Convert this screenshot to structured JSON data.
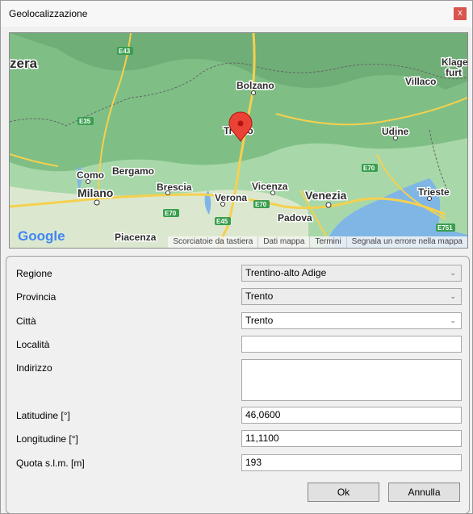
{
  "window": {
    "title": "Geolocalizzazione",
    "close_glyph": "x"
  },
  "map": {
    "places": {
      "zera": "zera",
      "klagenfurt": "Klage",
      "furt": "furt",
      "bolzano": "Bolzano",
      "villaco": "Villaco",
      "trento": "Trento",
      "udine": "Udine",
      "como": "Como",
      "bergamo": "Bergamo",
      "brescia": "Brescia",
      "milano": "Milano",
      "verona": "Verona",
      "vicenza": "Vicenza",
      "venezia": "Venezia",
      "padova": "Padova",
      "trieste": "Trieste",
      "piacenza": "Piacenza"
    },
    "roads": {
      "e43": "E43",
      "e35": "E35",
      "e70a": "E70",
      "e70b": "E70",
      "e70c": "E70",
      "e45": "E45",
      "e751": "E751"
    },
    "logo": "Google",
    "footer": {
      "shortcuts": "Scorciatoie da tastiera",
      "data": "Dati mappa",
      "terms": "Termini",
      "report": "Segnala un errore nella mappa"
    }
  },
  "form": {
    "regione": {
      "label": "Regione",
      "value": "Trentino-alto Adige"
    },
    "provincia": {
      "label": "Provincia",
      "value": "Trento"
    },
    "citta": {
      "label": "Città",
      "value": "Trento"
    },
    "localita": {
      "label": "Località",
      "value": ""
    },
    "indirizzo": {
      "label": "Indirizzo",
      "value": ""
    },
    "latitudine": {
      "label": "Latitudine [°]",
      "value": "46,0600"
    },
    "longitudine": {
      "label": "Longitudine [°]",
      "value": "11,1100"
    },
    "quota": {
      "label": "Quota s.l.m. [m]",
      "value": "193"
    }
  },
  "buttons": {
    "ok": "Ok",
    "cancel": "Annulla"
  }
}
